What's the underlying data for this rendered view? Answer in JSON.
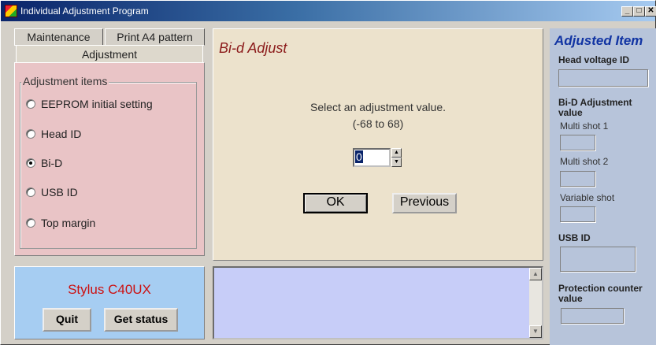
{
  "window": {
    "title": "Individual Adjustment Program",
    "controls": [
      "_",
      "□",
      "✕"
    ]
  },
  "left": {
    "tabs": [
      "Maintenance",
      "Print A4 pattern",
      "Adjustment"
    ],
    "group_label": "Adjustment items",
    "options": [
      {
        "label": "EEPROM initial setting",
        "selected": false
      },
      {
        "label": "Head ID",
        "selected": false
      },
      {
        "label": "Bi-D",
        "selected": true
      },
      {
        "label": "USB ID",
        "selected": false
      },
      {
        "label": "Top margin",
        "selected": false
      }
    ]
  },
  "status": {
    "model": "Stylus C40UX",
    "quit_label": "Quit",
    "get_status_label": "Get status"
  },
  "center": {
    "title": "Bi-d Adjust",
    "instruction": "Select an adjustment value.",
    "range": "(-68 to 68)",
    "value": "0",
    "ok_label": "OK",
    "previous_label": "Previous"
  },
  "right": {
    "title": "Adjusted Item",
    "head_voltage_label": "Head voltage ID",
    "bid_label": "Bi-D Adjustment value",
    "multi1_label": "Multi shot 1",
    "multi2_label": "Multi shot 2",
    "variable_label": "Variable shot",
    "usb_label": "USB ID",
    "protection_label": "Protection counter value"
  },
  "colors": {
    "left_panel_bg": "#e9c4c6",
    "status_panel_bg": "#a6cdf2",
    "center_panel_bg": "#ece2cc",
    "log_panel_bg": "#c7cdf8",
    "right_panel_bg": "#b7c4da",
    "accent_red": "#cc1111",
    "title_blue": "#1134a3"
  }
}
